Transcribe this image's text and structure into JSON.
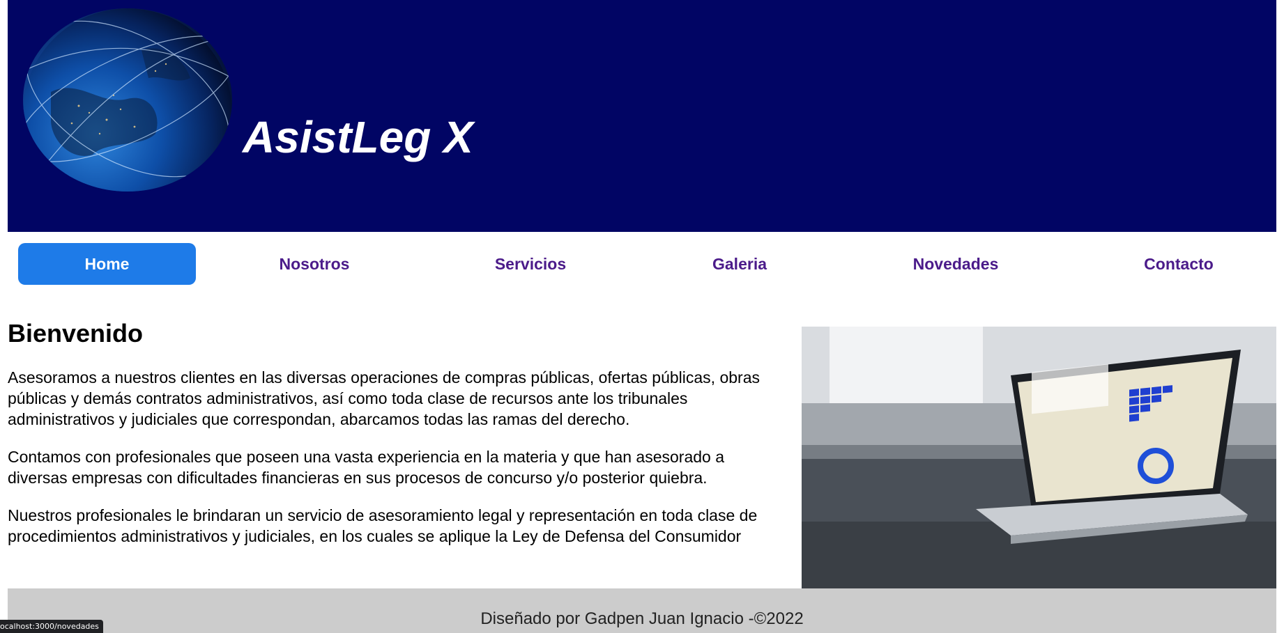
{
  "header": {
    "brand": "AsistLeg X",
    "background_color": "#010564",
    "logo_icon": "globe-icon"
  },
  "nav": {
    "items": [
      {
        "label": "Home",
        "active": true
      },
      {
        "label": "Nosotros",
        "active": false
      },
      {
        "label": "Servicios",
        "active": false
      },
      {
        "label": "Galeria",
        "active": false
      },
      {
        "label": "Novedades",
        "active": false
      },
      {
        "label": "Contacto",
        "active": false
      }
    ],
    "active_color": "#1e7be8",
    "link_color": "#4b1b8a"
  },
  "main": {
    "title": "Bienvenido",
    "paragraphs": [
      "Asesoramos a nuestros clientes en las diversas operaciones de compras públicas, ofertas públicas, obras públicas y demás contratos administrativos, así como toda clase de recursos ante los tribunales administrativos y judiciales que correspondan, abarcamos todas las ramas del derecho.",
      "Contamos con profesionales que poseen una vasta experiencia en la materia y que han asesorado a diversas empresas con dificultades financieras en sus procesos de concurso y/o posterior quiebra.",
      "Nuestros profesionales le brindaran un servicio de asesoramiento legal y representación en toda clase de procedimientos administrativos y judiciales, en los cuales se aplique la Ley de Defensa del Consumidor"
    ]
  },
  "footer": {
    "text": "Diseñado por Gadpen Juan Ignacio -©2022",
    "background_color": "#cccccc"
  },
  "status_bar": {
    "url": "ocalhost:3000/novedades"
  }
}
